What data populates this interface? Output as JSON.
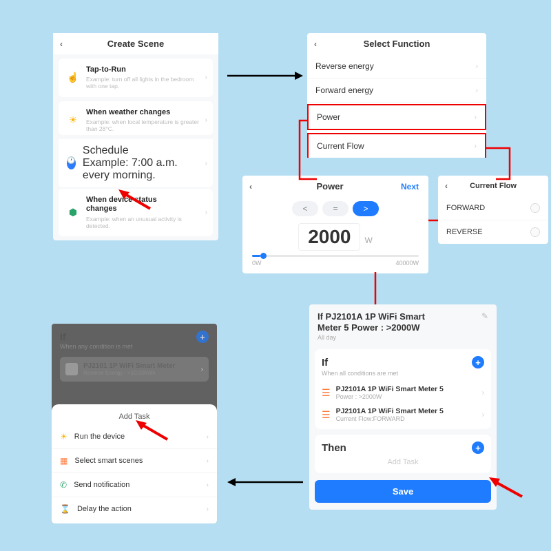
{
  "createScene": {
    "title": "Create Scene",
    "opts": [
      {
        "title": "Tap-to-Run",
        "sub": "Example: turn off all lights in the bedroom with one tap."
      },
      {
        "title": "When weather changes",
        "sub": "Example: when local temperature is greater than 28°C."
      },
      {
        "title": "Schedule",
        "sub": "Example: 7:00 a.m. every morning."
      },
      {
        "title": "When device status changes",
        "sub": "Example: when an unusual activity is detected."
      }
    ]
  },
  "selectFunction": {
    "title": "Select Function",
    "items": [
      "Reverse energy",
      "Forward energy",
      "Power",
      "Current Flow"
    ]
  },
  "power": {
    "title": "Power",
    "next": "Next",
    "lt": "<",
    "eq": "=",
    "gt": ">",
    "value": "2000",
    "unit": "W",
    "min": "0W",
    "max": "40000W"
  },
  "currentFlow": {
    "title": "Current Flow",
    "opts": [
      "FORWARD",
      "REVERSE"
    ]
  },
  "summary": {
    "title1": "If PJ2101A 1P WiFi Smart",
    "title2": "Meter  5 Power : >2000W",
    "allday": "All day",
    "ifLabel": "If",
    "ifSub": "When all conditions are met",
    "cond1_name": "PJ2101A 1P WiFi Smart Meter 5",
    "cond1_val": "Power : >2000W",
    "cond2_name": "PJ2101A 1P WiFi Smart Meter 5",
    "cond2_val": "Current Flow:FORWARD",
    "thenLabel": "Then",
    "addTask": "Add Task",
    "save": "Save"
  },
  "addTask": {
    "dimIf": "If",
    "dimSub": "When any condition is met",
    "dimDevice": "PJ2101 1P WiFi Smart Meter",
    "dimVal": "Reverse Energy : >10.00kWh",
    "title": "Add Task",
    "opts": [
      "Run the device",
      "Select smart scenes",
      "Send notification",
      "Delay the action"
    ]
  }
}
